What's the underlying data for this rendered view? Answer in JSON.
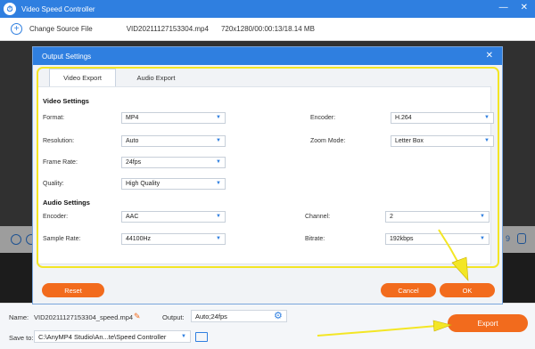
{
  "app": {
    "title": "Video Speed Controller"
  },
  "toolbar": {
    "change_source": "Change Source File",
    "file_name": "VID20211127153304.mp4",
    "file_meta": "720x1280/00:00:13/18.14 MB"
  },
  "dialog": {
    "title": "Output Settings",
    "tabs": [
      "Video Export",
      "Audio Export"
    ],
    "video_settings_label": "Video Settings",
    "audio_settings_label": "Audio Settings",
    "left_fields": [
      {
        "label": "Format:",
        "value": "MP4"
      },
      {
        "label": "Resolution:",
        "value": "Auto"
      },
      {
        "label": "Frame Rate:",
        "value": "24fps"
      },
      {
        "label": "Quality:",
        "value": "High Quality"
      }
    ],
    "right_fields": [
      {
        "label": "Encoder:",
        "value": "H.264"
      },
      {
        "label": "Zoom Mode:",
        "value": "Letter Box"
      }
    ],
    "audio_left": [
      {
        "label": "Encoder:",
        "value": "AAC"
      },
      {
        "label": "Sample Rate:",
        "value": "44100Hz"
      }
    ],
    "audio_right": [
      {
        "label": "Channel:",
        "value": "2"
      },
      {
        "label": "Bitrate:",
        "value": "192kbps"
      }
    ],
    "reset_label": "Reset",
    "cancel_label": "Cancel",
    "ok_label": "OK"
  },
  "bottom": {
    "name_label": "Name:",
    "name_value": "VID20211127153304_speed.mp4",
    "output_label": "Output:",
    "output_value": "Auto;24fps",
    "saveto_label": "Save to:",
    "saveto_value": "C:\\AnyMP4 Studio\\An...te\\Speed Controller",
    "export_label": "Export"
  },
  "colors": {
    "accent": "#2f7fe0",
    "action": "#f26b1d",
    "highlight": "#f3e625"
  }
}
